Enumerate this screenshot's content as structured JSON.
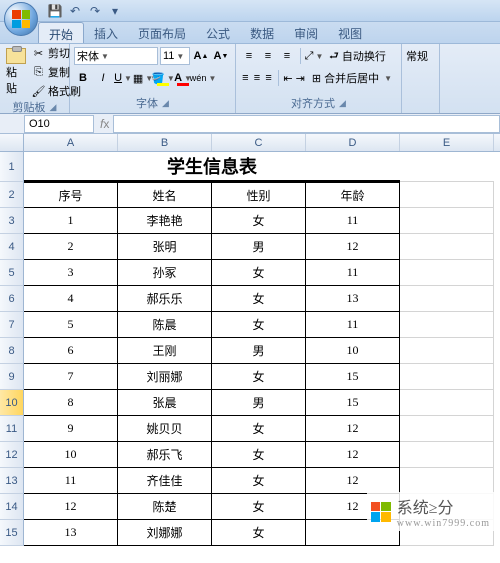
{
  "qat": {
    "save": "💾",
    "undo": "↶",
    "redo": "↷",
    "more": "▾"
  },
  "tabs": [
    "开始",
    "插入",
    "页面布局",
    "公式",
    "数据",
    "审阅",
    "视图"
  ],
  "active_tab_index": 0,
  "ribbon": {
    "clipboard": {
      "paste": "粘贴",
      "cut": "剪切",
      "copy": "复制",
      "format_painter": "格式刷",
      "group_label": "剪贴板"
    },
    "font": {
      "font_name": "宋体",
      "font_size": "11",
      "group_label": "字体"
    },
    "alignment": {
      "wrap": "自动换行",
      "merge": "合并后居中",
      "group_label": "对齐方式"
    },
    "number": {
      "label": "常规"
    }
  },
  "namebox": "O10",
  "columns": [
    "A",
    "B",
    "C",
    "D",
    "E"
  ],
  "row_numbers": [
    "1",
    "2",
    "3",
    "4",
    "5",
    "6",
    "7",
    "8",
    "9",
    "10",
    "11",
    "12",
    "13",
    "14",
    "15"
  ],
  "selected_row": "10",
  "sheet": {
    "title": "学生信息表",
    "headers": [
      "序号",
      "姓名",
      "性别",
      "年龄"
    ],
    "rows": [
      [
        "1",
        "李艳艳",
        "女",
        "11"
      ],
      [
        "2",
        "张明",
        "男",
        "12"
      ],
      [
        "3",
        "孙冢",
        "女",
        "11"
      ],
      [
        "4",
        "郝乐乐",
        "女",
        "13"
      ],
      [
        "5",
        "陈晨",
        "女",
        "11"
      ],
      [
        "6",
        "王刚",
        "男",
        "10"
      ],
      [
        "7",
        "刘丽娜",
        "女",
        "15"
      ],
      [
        "8",
        "张晨",
        "男",
        "15"
      ],
      [
        "9",
        "姚贝贝",
        "女",
        "12"
      ],
      [
        "10",
        "郝乐飞",
        "女",
        "12"
      ],
      [
        "11",
        "齐佳佳",
        "女",
        "12"
      ],
      [
        "12",
        "陈楚",
        "女",
        "12"
      ],
      [
        "13",
        "刘娜娜",
        "女",
        ""
      ]
    ]
  },
  "watermark": {
    "text": "系统≥分",
    "sub": "www.win7999.com"
  }
}
